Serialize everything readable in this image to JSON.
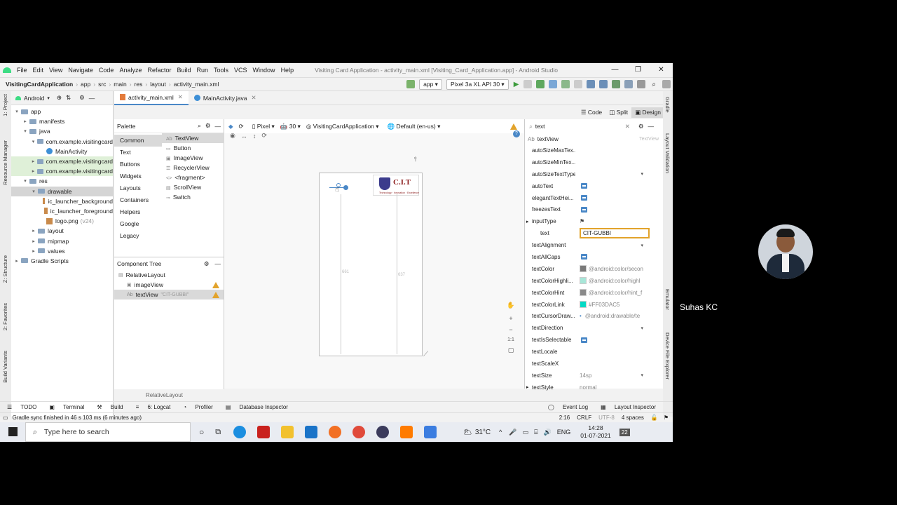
{
  "window": {
    "menu": [
      "File",
      "Edit",
      "View",
      "Navigate",
      "Code",
      "Analyze",
      "Refactor",
      "Build",
      "Run",
      "Tools",
      "VCS",
      "Window",
      "Help"
    ],
    "title": "Visiting Card Application - activity_main.xml [Visiting_Card_Application.app] - Android Studio",
    "controls": [
      "—",
      "❐",
      "✕"
    ]
  },
  "navbar": {
    "crumbs": [
      "VisitingCardApplication",
      "app",
      "src",
      "main",
      "res",
      "layout",
      "activity_main.xml"
    ],
    "run_config": "app",
    "device": "Pixel 3a XL API 30"
  },
  "project": {
    "view": "Android",
    "tree": [
      {
        "label": "app",
        "depth": 0,
        "kind": "folder",
        "arrow": "▾"
      },
      {
        "label": "manifests",
        "depth": 1,
        "kind": "folder",
        "arrow": "▸"
      },
      {
        "label": "java",
        "depth": 1,
        "kind": "folder",
        "arrow": "▾"
      },
      {
        "label": "com.example.visitingcard",
        "depth": 2,
        "kind": "folder",
        "arrow": "▾"
      },
      {
        "label": "MainActivity",
        "depth": 3,
        "kind": "class",
        "arrow": ""
      },
      {
        "label": "com.example.visitingcard",
        "depth": 2,
        "kind": "folder",
        "arrow": "▸",
        "hl": true
      },
      {
        "label": "com.example.visitingcard",
        "depth": 2,
        "kind": "folder",
        "arrow": "▸",
        "hl": true
      },
      {
        "label": "res",
        "depth": 1,
        "kind": "folder",
        "arrow": "▾"
      },
      {
        "label": "drawable",
        "depth": 2,
        "kind": "folder",
        "arrow": "▾",
        "sel": true
      },
      {
        "label": "ic_launcher_background",
        "depth": 3,
        "kind": "image",
        "arrow": ""
      },
      {
        "label": "ic_launcher_foreground",
        "depth": 3,
        "kind": "image",
        "arrow": ""
      },
      {
        "label": "logo.png",
        "suffix": "(v24)",
        "depth": 3,
        "kind": "image",
        "arrow": ""
      },
      {
        "label": "layout",
        "depth": 2,
        "kind": "folder",
        "arrow": "▸"
      },
      {
        "label": "mipmap",
        "depth": 2,
        "kind": "folder",
        "arrow": "▸"
      },
      {
        "label": "values",
        "depth": 2,
        "kind": "folder",
        "arrow": "▸"
      },
      {
        "label": "Gradle Scripts",
        "depth": 0,
        "kind": "folder",
        "arrow": "▸"
      }
    ]
  },
  "tabs": [
    {
      "label": "activity_main.xml",
      "active": true
    },
    {
      "label": "MainActivity.java",
      "active": false
    }
  ],
  "view_modes": {
    "code": "Code",
    "split": "Split",
    "design": "Design"
  },
  "palette": {
    "title": "Palette",
    "categories": [
      "Common",
      "Text",
      "Buttons",
      "Widgets",
      "Layouts",
      "Containers",
      "Helpers",
      "Google",
      "Legacy"
    ],
    "items": [
      "TextView",
      "Button",
      "ImageView",
      "RecyclerView",
      "<fragment>",
      "ScrollView",
      "Switch"
    ]
  },
  "design_toolbar": {
    "device": "Pixel",
    "api": "30",
    "theme": "VisitingCardApplication",
    "locale": "Default (en-us)"
  },
  "component_tree": {
    "title": "Component Tree",
    "items": [
      {
        "label": "RelativeLayout",
        "depth": 0
      },
      {
        "label": "imageView",
        "depth": 1,
        "warn": true
      },
      {
        "label": "textView",
        "sub": "\"CIT-GUBBI\"",
        "depth": 1,
        "warn": true,
        "sel": true
      }
    ]
  },
  "canvas": {
    "logo_text": "C.I.T",
    "logo_tagline": "Technology · Innovation · Excellence",
    "dim_left": "661",
    "dim_right": "637",
    "breadcrumb": "RelativeLayout",
    "zoom_label": "1:1"
  },
  "attributes": {
    "search": "text",
    "component": "textView",
    "component_type": "TextView",
    "rows": [
      {
        "name": "autoSizeMaxTex...",
        "type": "empty"
      },
      {
        "name": "autoSizeMinTex...",
        "type": "empty"
      },
      {
        "name": "autoSizeTextType",
        "type": "dropdown"
      },
      {
        "name": "autoText",
        "type": "check"
      },
      {
        "name": "elegantTextHei...",
        "type": "check"
      },
      {
        "name": "freezesText",
        "type": "check"
      },
      {
        "name": "inputType",
        "type": "flag",
        "expand": true
      },
      {
        "name": "text",
        "type": "input",
        "value": "CIT-GUBBI",
        "indent": true
      },
      {
        "name": "textAlignment",
        "type": "dropdown"
      },
      {
        "name": "textAllCaps",
        "type": "check"
      },
      {
        "name": "textColor",
        "type": "color",
        "value": "@android:color/secon",
        "color": "#7a7a7a"
      },
      {
        "name": "textColorHighli...",
        "type": "color",
        "value": "@android:color/highl",
        "color": "#a8e6d8"
      },
      {
        "name": "textColorHint",
        "type": "color",
        "value": "@android:color/hint_f",
        "color": "#8a8a8a"
      },
      {
        "name": "textColorLink",
        "type": "color",
        "value": "#FF03DAC5",
        "color": "#03DAC5"
      },
      {
        "name": "textCursorDraw...",
        "type": "dot",
        "value": "@android:drawable/te"
      },
      {
        "name": "textDirection",
        "type": "dropdown"
      },
      {
        "name": "textIsSelectable",
        "type": "check"
      },
      {
        "name": "textLocale",
        "type": "empty"
      },
      {
        "name": "textScaleX",
        "type": "empty"
      },
      {
        "name": "textSize",
        "type": "text-dd",
        "value": "14sp"
      },
      {
        "name": "textStyle",
        "type": "text",
        "value": "normal",
        "expand": true
      }
    ]
  },
  "side_strips": {
    "left": [
      "1: Project",
      "Resource Manager",
      "Z: Structure",
      "2: Favorites",
      "Build Variants"
    ],
    "right": [
      "Gradle",
      "Layout Validation",
      "Emulator",
      "Device File Explorer"
    ]
  },
  "tool_windows": {
    "left": [
      "TODO",
      "Terminal",
      "Build",
      "6: Logcat",
      "Profiler",
      "Database Inspector"
    ],
    "right": [
      "Event Log",
      "Layout Inspector"
    ]
  },
  "status": {
    "message": "Gradle sync finished in 46 s 103 ms (6 minutes ago)",
    "position": "2:16",
    "line_sep": "CRLF",
    "encoding": "UTF-8",
    "indent": "4 spaces"
  },
  "taskbar": {
    "search_placeholder": "Type here to search",
    "weather": "31°C",
    "lang": "ENG",
    "time": "14:28",
    "date": "01-07-2021",
    "notif_count": "22"
  },
  "participant": {
    "name": "Suhas KC"
  },
  "colors": {
    "accent": "#4a88c7",
    "warning": "#e2a32b",
    "selected_input_border": "#e2a32b"
  }
}
